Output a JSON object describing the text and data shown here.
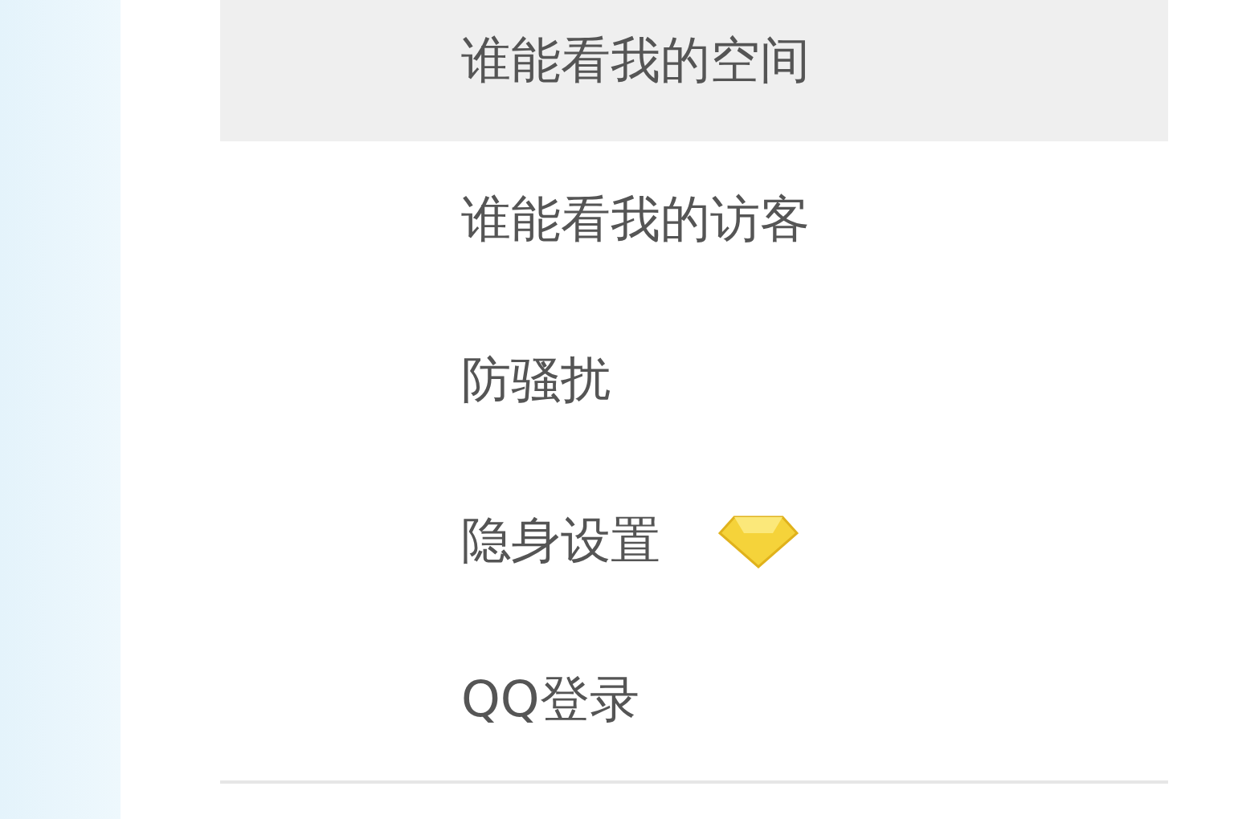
{
  "menu": {
    "items": [
      {
        "label": "谁能看我的空间",
        "selected": true,
        "vip": false
      },
      {
        "label": "谁能看我的访客",
        "selected": false,
        "vip": false
      },
      {
        "label": "防骚扰",
        "selected": false,
        "vip": false
      },
      {
        "label": "隐身设置",
        "selected": false,
        "vip": true
      },
      {
        "label": "QQ登录",
        "selected": false,
        "vip": false
      }
    ]
  }
}
